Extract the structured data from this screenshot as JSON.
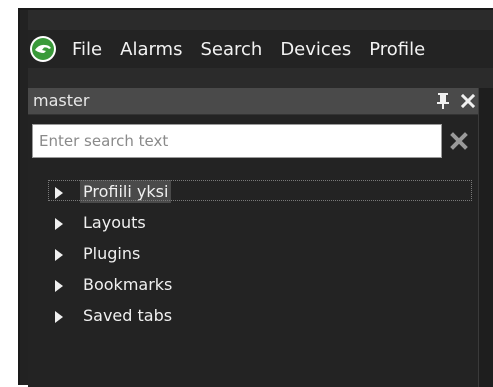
{
  "menubar": {
    "logo_icon": "app-logo-icon",
    "items": [
      "File",
      "Alarms",
      "Search",
      "Devices",
      "Profile"
    ]
  },
  "panel": {
    "title": "master",
    "pin_icon": "pin-icon",
    "close_icon": "close-icon"
  },
  "search": {
    "placeholder": "Enter search text",
    "value": "",
    "clear_icon": "clear-icon"
  },
  "tree": {
    "items": [
      {
        "label": "Profiili yksi",
        "selected": true
      },
      {
        "label": "Layouts",
        "selected": false
      },
      {
        "label": "Plugins",
        "selected": false
      },
      {
        "label": "Bookmarks",
        "selected": false
      },
      {
        "label": "Saved tabs",
        "selected": false
      }
    ]
  },
  "colors": {
    "background": "#232323",
    "header": "#4a4a4a",
    "logo_green": "#3a9a3a",
    "text": "#f0f0f0"
  }
}
